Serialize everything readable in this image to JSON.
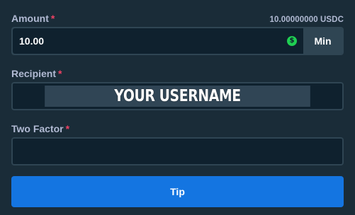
{
  "amount": {
    "label": "Amount",
    "required_mark": "*",
    "balance": "10.00000000 USDC",
    "value": "10.00",
    "currency_icon": "dollar-coin-icon",
    "currency_symbol": "$",
    "min_label": "Min"
  },
  "recipient": {
    "label": "Recipient",
    "required_mark": "*",
    "value": "YOUR USERNAME"
  },
  "two_factor": {
    "label": "Two Factor",
    "required_mark": "*",
    "value": ""
  },
  "submit": {
    "label": "Tip"
  },
  "colors": {
    "background": "#1a2c38",
    "input_background": "#0f212e",
    "border": "#2f4553",
    "label": "#b1bad3",
    "required": "#ed4163",
    "coin": "#1fcf52",
    "button": "#1475e1"
  }
}
